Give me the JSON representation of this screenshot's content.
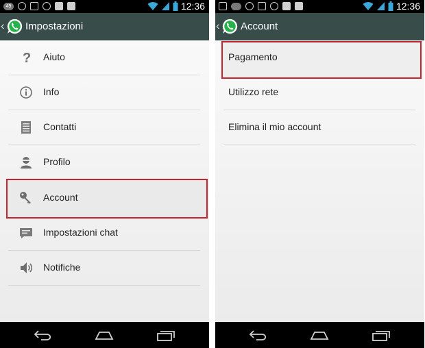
{
  "left_screen": {
    "status_bar": {
      "time": "12:36",
      "notification_badge": "49",
      "icons": [
        "notification-count-icon",
        "sun-icon",
        "sync-icon",
        "alarm-icon",
        "play-store-icon",
        "play-store-icon",
        "wifi-icon",
        "signal-icon",
        "battery-icon"
      ]
    },
    "action_bar": {
      "title": "Impostazioni",
      "app_icon": "whatsapp-logo-icon"
    },
    "menu": [
      {
        "label": "Aiuto",
        "icon": "question-mark-icon"
      },
      {
        "label": "Info",
        "icon": "info-icon"
      },
      {
        "label": "Contatti",
        "icon": "contacts-list-icon"
      },
      {
        "label": "Profilo",
        "icon": "profile-icon"
      },
      {
        "label": "Account",
        "icon": "key-icon",
        "highlighted": true
      },
      {
        "label": "Impostazioni chat",
        "icon": "chat-icon"
      },
      {
        "label": "Notifiche",
        "icon": "speaker-icon"
      }
    ],
    "nav_bar": [
      "back-icon",
      "home-icon",
      "recent-apps-icon"
    ]
  },
  "right_screen": {
    "status_bar": {
      "time": "12:36",
      "icons": [
        "image-icon",
        "notification-count-icon",
        "sun-icon",
        "sync-icon",
        "alarm-icon",
        "play-store-icon",
        "play-store-icon",
        "wifi-icon",
        "signal-icon",
        "battery-icon"
      ]
    },
    "action_bar": {
      "title": "Account",
      "app_icon": "whatsapp-logo-icon"
    },
    "menu": [
      {
        "label": "Pagamento",
        "highlighted": true
      },
      {
        "label": "Utilizzo rete"
      },
      {
        "label": "Elimina il mio account"
      }
    ],
    "nav_bar": [
      "back-icon",
      "home-icon",
      "recent-apps-icon"
    ]
  },
  "colors": {
    "action_bar": "#384c4a",
    "highlight_border": "#c4242f",
    "whatsapp_green": "#25b34a",
    "status_bar": "#000000"
  }
}
